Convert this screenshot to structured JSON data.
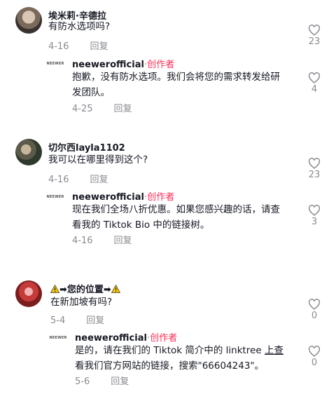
{
  "threads": [
    {
      "comment": {
        "username": "埃米莉·辛德拉",
        "text": "有防水选项吗?",
        "date": "4-16",
        "reply_label": "回复",
        "likes": "23"
      },
      "reply": {
        "avatar_text": "NEEWER",
        "username": "neewerofficial",
        "separator": "·",
        "creator_label": "创作者",
        "text_line1": "抱歉，没有防水选项。我们会将您的需求转发给研",
        "text_line2": "发团队。",
        "date": "4-25",
        "reply_label": "回复",
        "likes": "4"
      }
    },
    {
      "comment": {
        "username": "切尔西layla1102",
        "text": "我可以在哪里得到这个?",
        "date": "4-16",
        "reply_label": "回复",
        "likes": "23"
      },
      "reply": {
        "avatar_text": "NEEWER",
        "username": "neewerofficial",
        "separator": "·",
        "creator_label": "创作者",
        "text_line1": "现在我们全场八折优惠。如果您感兴趣的话，请查",
        "text_line2": "看我的 Tiktok Bio 中的链接树。",
        "date": "4-16",
        "reply_label": "回复",
        "likes": "3"
      }
    },
    {
      "comment": {
        "username_arrow1": "➡",
        "username_middle": "您的位置",
        "username_arrow2": "➡",
        "text": "在新加坡有吗?",
        "date": "5-4",
        "reply_label": "回复",
        "likes": "0"
      },
      "reply": {
        "avatar_text": "NEEWER",
        "username": "neewerofficial",
        "separator": "·",
        "creator_label": "创作者",
        "text_line1_a": "是的，请在我们的 Tiktok 简介中的 linktree ",
        "text_line1_link": "上查",
        "text_line2": "看我们官方网站的链接，搜索\"66604243\"。",
        "date": "5-6",
        "reply_label": "回复",
        "likes": "0"
      }
    }
  ],
  "icons": {
    "like": "heart-outline-icon",
    "warning": "warning-icon",
    "arrow": "arrow-right-icon"
  },
  "colors": {
    "creator": "#fe2c55",
    "meta": "#8a8b91",
    "text": "#161823"
  }
}
